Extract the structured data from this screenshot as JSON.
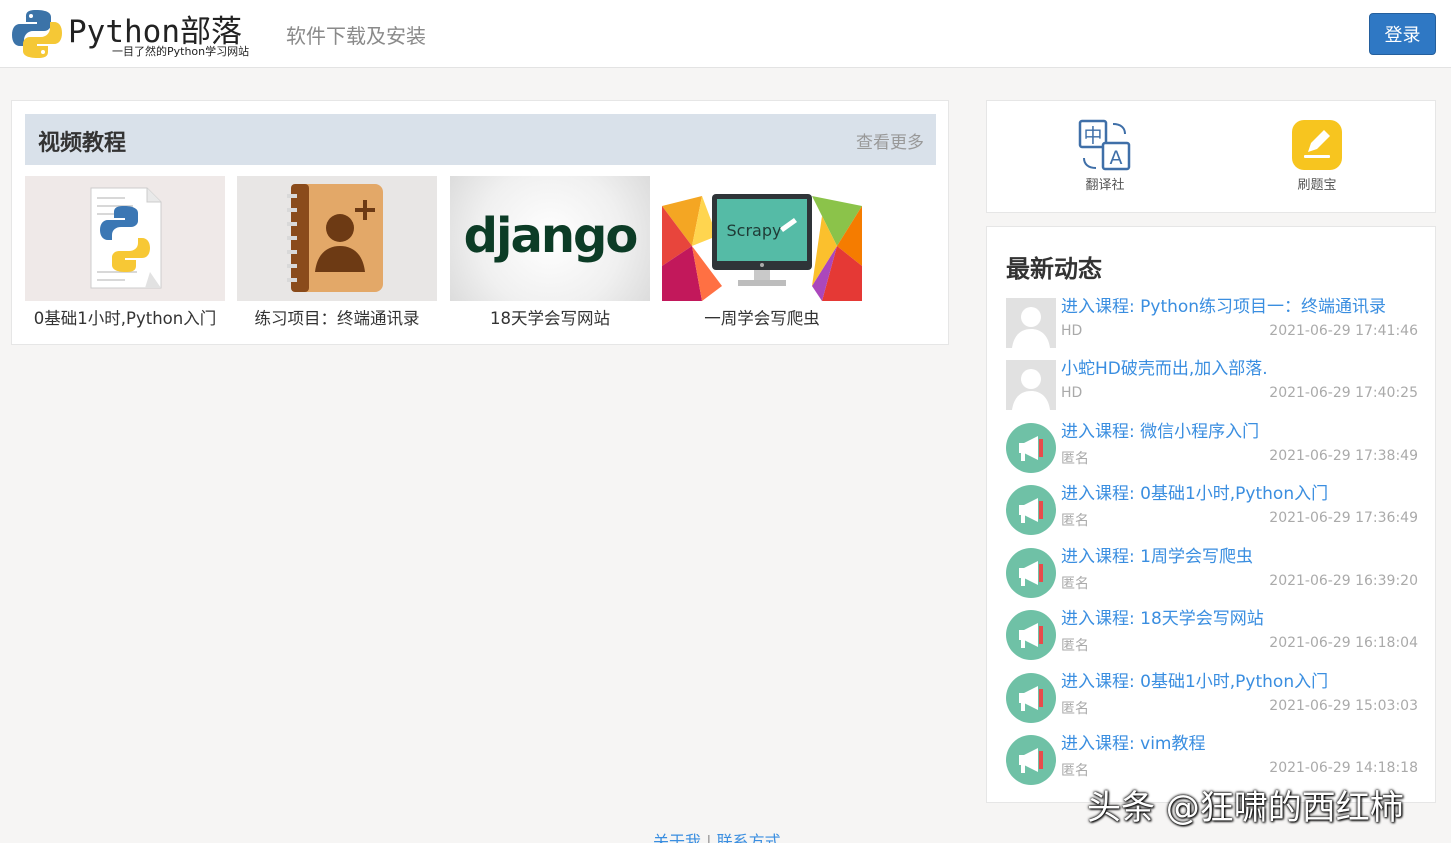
{
  "header": {
    "logo_text": "Python部落",
    "logo_sub": "一目了然的Python学习网站",
    "nav_link": "软件下载及安装",
    "login_label": "登录"
  },
  "video": {
    "title": "视频教程",
    "more": "查看更多",
    "courses": [
      {
        "label": "0基础1小时,Python入门",
        "icon": "python-file-icon"
      },
      {
        "label": "练习项目：终端通讯录",
        "icon": "address-book-icon"
      },
      {
        "label": "18天学会写网站",
        "icon": "django-logo",
        "logo_text": "django"
      },
      {
        "label": "一周学会写爬虫",
        "icon": "scrapy-monitor-icon",
        "logo_text": "Scrapy"
      }
    ]
  },
  "tools": [
    {
      "label": "翻译社",
      "icon": "translate-icon",
      "glyph_a": "中",
      "glyph_b": "A"
    },
    {
      "label": "刷题宝",
      "icon": "pencil-icon"
    }
  ],
  "feed": {
    "title": "最新动态",
    "items": [
      {
        "text": "进入课程: Python练习项目一：终端通讯录",
        "user": "HD",
        "time": "2021-06-29 17:41:46",
        "avatar": "user-avatar"
      },
      {
        "text": "小蛇HD破壳而出,加入部落.",
        "user": "HD",
        "time": "2021-06-29 17:40:25",
        "avatar": "user-avatar"
      },
      {
        "text": "进入课程: 微信小程序入门",
        "user": "匿名",
        "time": "2021-06-29 17:38:49",
        "avatar": "megaphone-icon"
      },
      {
        "text": "进入课程: 0基础1小时,Python入门",
        "user": "匿名",
        "time": "2021-06-29 17:36:49",
        "avatar": "megaphone-icon"
      },
      {
        "text": "进入课程: 1周学会写爬虫",
        "user": "匿名",
        "time": "2021-06-29 16:39:20",
        "avatar": "megaphone-icon"
      },
      {
        "text": "进入课程: 18天学会写网站",
        "user": "匿名",
        "time": "2021-06-29 16:18:04",
        "avatar": "megaphone-icon"
      },
      {
        "text": "进入课程: 0基础1小时,Python入门",
        "user": "匿名",
        "time": "2021-06-29 15:03:03",
        "avatar": "megaphone-icon"
      },
      {
        "text": "进入课程: vim教程",
        "user": "匿名",
        "time": "2021-06-29 14:18:18",
        "avatar": "megaphone-icon"
      }
    ]
  },
  "footer": {
    "about": "关于我",
    "sep": "|",
    "contact": "联系方式"
  },
  "watermark": "头条 @狂啸的西红柿",
  "colors": {
    "accent": "#2f78c4",
    "link": "#3a8ee0",
    "feed_avatar": "#6fc1a6",
    "pencil_bg": "#f7c51f"
  }
}
